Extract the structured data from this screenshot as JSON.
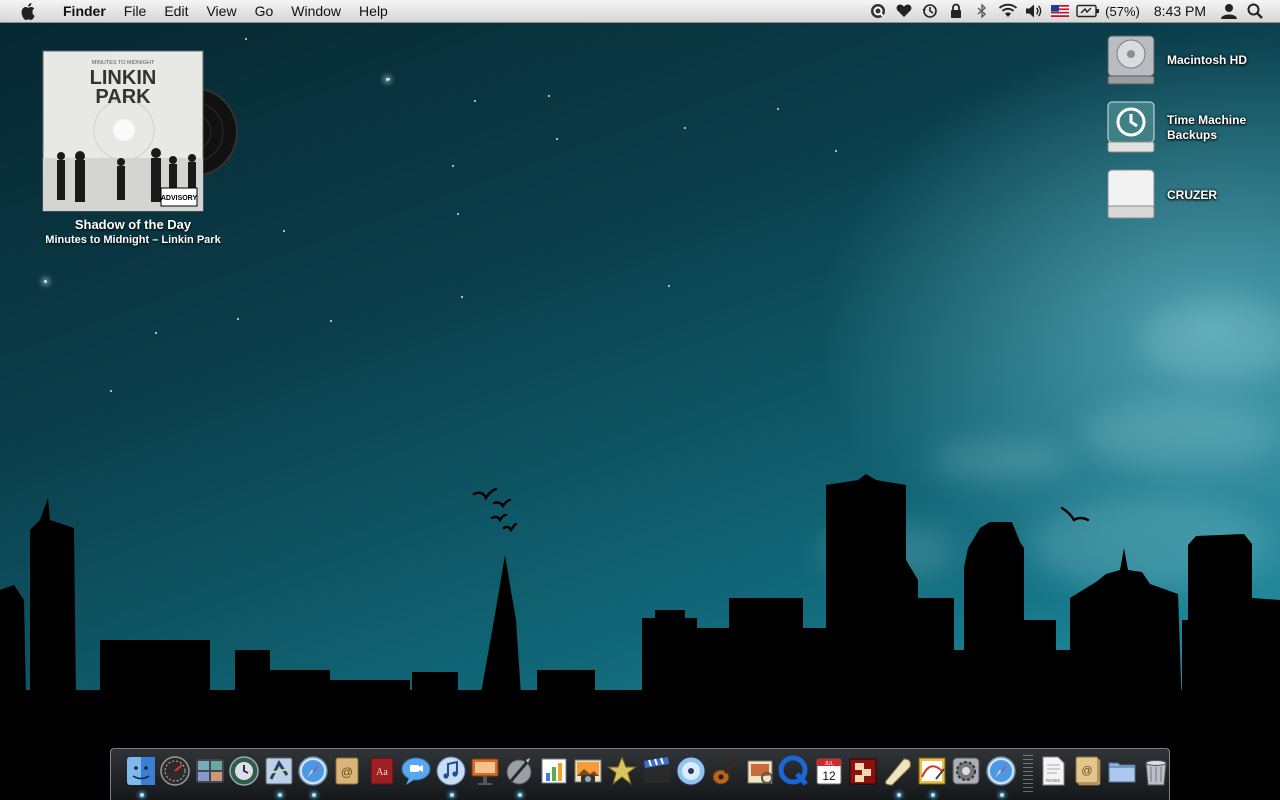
{
  "menubar": {
    "app_name": "Finder",
    "menus": [
      "File",
      "Edit",
      "View",
      "Go",
      "Window",
      "Help"
    ],
    "status": {
      "battery_percent": "(57%)",
      "clock": "8:43 PM",
      "icons": [
        "quicksilver-icon",
        "heart-icon",
        "time-machine-icon",
        "lock-icon",
        "bluetooth-icon",
        "wifi-icon",
        "volume-icon",
        "us-flag-icon",
        "battery-icon",
        "user-icon",
        "spotlight-icon"
      ]
    }
  },
  "now_playing": {
    "cover_text_top": "MINUTES TO MIDNIGHT",
    "cover_text_band_1": "LINKIN",
    "cover_text_band_2": "PARK",
    "cover_advisory": "ADVISORY",
    "title": "Shadow of the Day",
    "subtitle": "Minutes to Midnight – Linkin Park"
  },
  "desktop_icons": [
    {
      "name": "Macintosh HD",
      "icon": "hard-drive-icon"
    },
    {
      "name": "Time Machine Backups",
      "icon": "time-machine-drive-icon"
    },
    {
      "name": "CRUZER",
      "icon": "usb-drive-icon"
    }
  ],
  "dock": {
    "items": [
      {
        "name": "Finder",
        "icon": "finder-icon",
        "running": true
      },
      {
        "name": "Dashboard",
        "icon": "dashboard-icon",
        "running": false
      },
      {
        "name": "Spaces",
        "icon": "spaces-icon",
        "running": false
      },
      {
        "name": "Time Machine",
        "icon": "time-machine-icon",
        "running": false
      },
      {
        "name": "Mail",
        "icon": "mail-icon",
        "running": true
      },
      {
        "name": "Safari",
        "icon": "safari-icon",
        "running": true
      },
      {
        "name": "Address Book",
        "icon": "address-book-icon",
        "running": false
      },
      {
        "name": "Dictionary",
        "icon": "dictionary-icon",
        "running": false
      },
      {
        "name": "iChat",
        "icon": "ichat-icon",
        "running": false
      },
      {
        "name": "iTunes",
        "icon": "itunes-icon",
        "running": true
      },
      {
        "name": "Keynote",
        "icon": "keynote-icon",
        "running": false
      },
      {
        "name": "Script Editor",
        "icon": "script-editor-icon",
        "running": true
      },
      {
        "name": "Numbers",
        "icon": "numbers-icon",
        "running": false
      },
      {
        "name": "iPhoto",
        "icon": "iphoto-icon",
        "running": false
      },
      {
        "name": "iMovie",
        "icon": "imovie-icon",
        "running": false
      },
      {
        "name": "iMovie HD",
        "icon": "clapper-icon",
        "running": false
      },
      {
        "name": "DVD Player",
        "icon": "dvd-player-icon",
        "running": false
      },
      {
        "name": "GarageBand",
        "icon": "garageband-icon",
        "running": false
      },
      {
        "name": "Preview",
        "icon": "preview-icon",
        "running": false
      },
      {
        "name": "QuickTime",
        "icon": "quicktime-icon",
        "running": false
      },
      {
        "name": "iCal",
        "icon": "ical-icon",
        "running": false,
        "label": "12",
        "month": "JUL"
      },
      {
        "name": "Photo Booth",
        "icon": "photo-booth-icon",
        "running": false
      },
      {
        "name": "Scroll",
        "icon": "scroll-icon",
        "running": true
      },
      {
        "name": "Grapher",
        "icon": "grapher-icon",
        "running": true
      },
      {
        "name": "System Preferences",
        "icon": "system-preferences-icon",
        "running": false
      },
      {
        "name": "Safari Beta",
        "icon": "safari-icon",
        "running": true
      },
      {
        "name": "Pages Document",
        "icon": "pages-document-icon",
        "running": false,
        "label": "PAGES"
      },
      {
        "name": "Address Book Stack",
        "icon": "address-stack-icon",
        "running": false
      },
      {
        "name": "Documents",
        "icon": "folder-icon",
        "running": false
      },
      {
        "name": "Trash",
        "icon": "trash-icon",
        "running": false
      }
    ]
  }
}
